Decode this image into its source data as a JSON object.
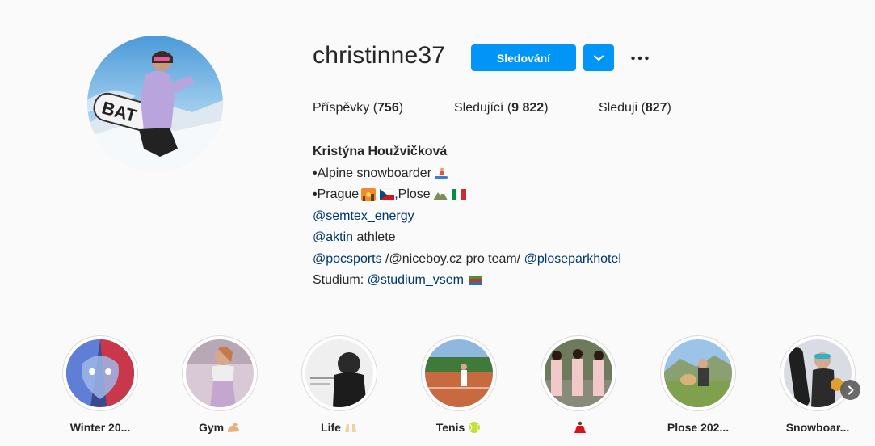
{
  "profile": {
    "username": "christinne37",
    "follow_label": "Sledování",
    "more_label": "•••"
  },
  "stats": {
    "posts_label": "Příspěvky",
    "posts_count": "756",
    "followers_label": "Sledující",
    "followers_count": "9 822",
    "following_label": "Sleduji",
    "following_count": "827"
  },
  "bio": {
    "name": "Kristýna Houžvičková",
    "line1": "•Alpine snowboarder",
    "line2a": "•Prague",
    "line2b": ",Plose",
    "line3_link": "@semtex_energy",
    "line4_link": "@aktin",
    "line4_text": " athlete",
    "line5_link1": "@pocsports",
    "line5_text": " /@niceboy.cz pro team/ ",
    "line5_link2": "@ploseparkhotel",
    "line6_text": "Studium: ",
    "line6_link": "@studium_vsem"
  },
  "highlights": [
    {
      "label": "Winter 20...",
      "icon": "lion-art-icon"
    },
    {
      "label": "Gym",
      "icon": "flexed-biceps-emoji"
    },
    {
      "label": "Life",
      "icon": "raised-hands-emoji"
    },
    {
      "label": "Tenis",
      "icon": "tennis-ball-emoji"
    },
    {
      "label": "",
      "icon": "dancer-emoji"
    },
    {
      "label": "Plose 202...",
      "icon": "dog-mountain"
    },
    {
      "label": "Snowboar...",
      "icon": "snowboard-photo"
    }
  ],
  "colors": {
    "primary_button": "#0095f6",
    "link": "#00376b",
    "text": "#262626",
    "background": "#fafafa"
  }
}
